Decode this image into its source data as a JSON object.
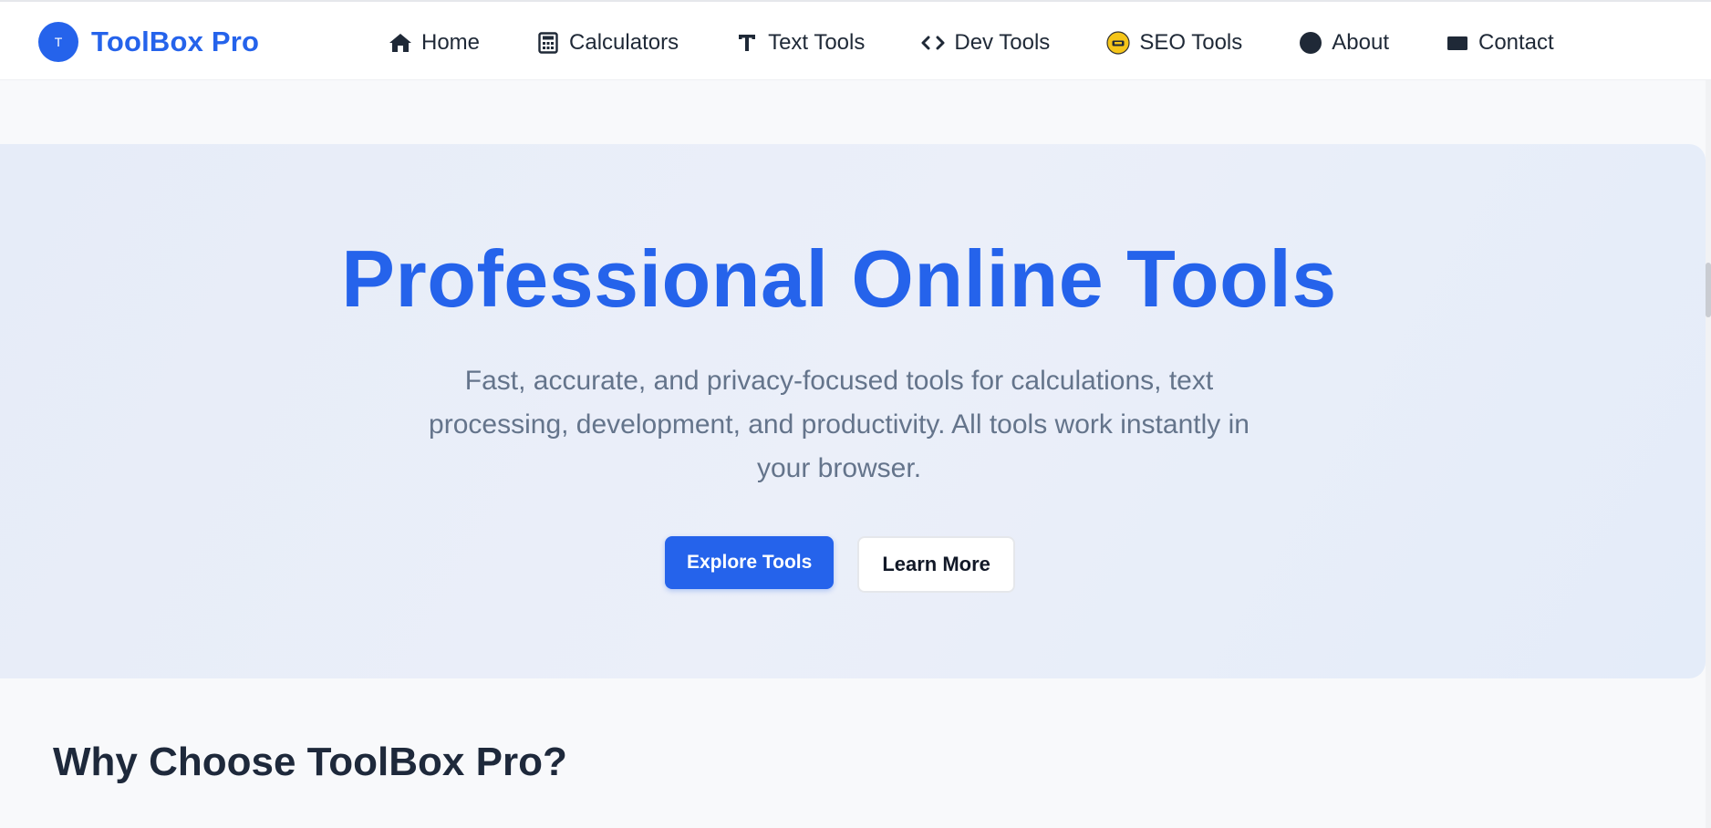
{
  "brand": {
    "logo_letter": "T",
    "name": "ToolBox Pro"
  },
  "nav": {
    "items": [
      {
        "label": "Home",
        "icon": "home-icon"
      },
      {
        "label": "Calculators",
        "icon": "calculator-icon"
      },
      {
        "label": "Text Tools",
        "icon": "text-icon"
      },
      {
        "label": "Dev Tools",
        "icon": "code-icon"
      },
      {
        "label": "SEO Tools",
        "icon": "seo-emoji-icon"
      },
      {
        "label": "About",
        "icon": "info-circle-icon"
      },
      {
        "label": "Contact",
        "icon": "envelope-icon"
      }
    ]
  },
  "hero": {
    "title": "Professional Online Tools",
    "subtitle": "Fast, accurate, and privacy-focused tools for calculations, text processing, development, and productivity. All tools work instantly in your browser.",
    "primary_button": "Explore Tools",
    "secondary_button": "Learn More"
  },
  "section": {
    "title": "Why Choose ToolBox Pro?"
  },
  "colors": {
    "accent": "#2563eb",
    "text": "#1e293b",
    "muted": "#64748b",
    "hero_bg": "#e8eef9"
  }
}
